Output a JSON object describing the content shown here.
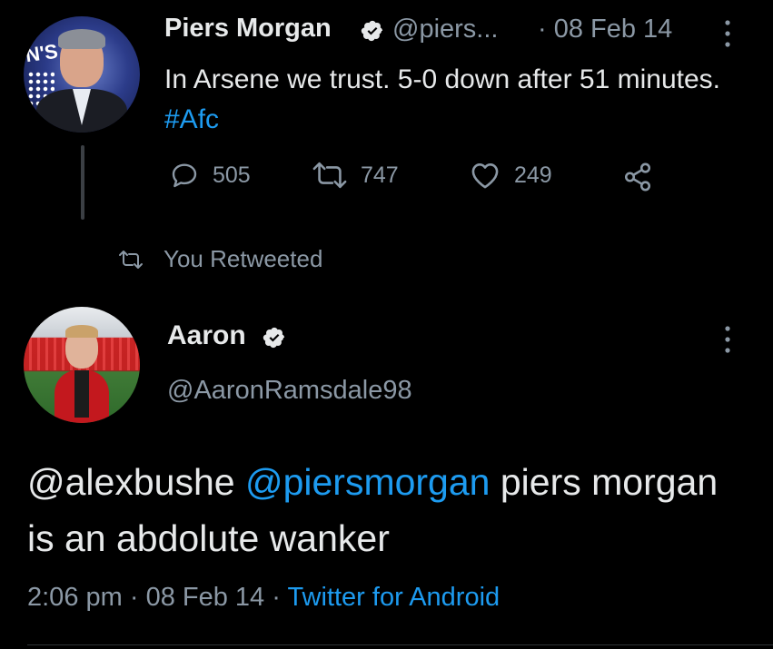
{
  "first_tweet": {
    "display_name": "Piers Morgan",
    "handle": "@piers...",
    "date": "· 08 Feb 14",
    "text_prefix": "In Arsene we trust. 5-0 down after 51 minutes. ",
    "hashtag": "#Afc",
    "avatar_text": "N'S",
    "reply_count": "505",
    "retweet_count": "747",
    "like_count": "249"
  },
  "retweet_notice": {
    "label": "You Retweeted"
  },
  "second_tweet": {
    "display_name": "Aaron",
    "handle": "@AaronRamsdale98",
    "mention1": "@alexbushe",
    "mention2": "@piersmorgan",
    "text_rest": " piers morgan is an abdolute wanker",
    "time": "2:06 pm",
    "date": "08 Feb 14",
    "source": "Twitter for Android",
    "separator": " · "
  },
  "colors": {
    "background": "#000000",
    "primary_text": "#e7e9ea",
    "secondary_text": "#8b98a5",
    "link": "#1d9bf0"
  },
  "icons": {
    "verified": "verified-badge-icon",
    "more": "more-vertical-icon",
    "reply": "reply-icon",
    "retweet": "retweet-icon",
    "like": "heart-icon",
    "share": "share-icon"
  }
}
